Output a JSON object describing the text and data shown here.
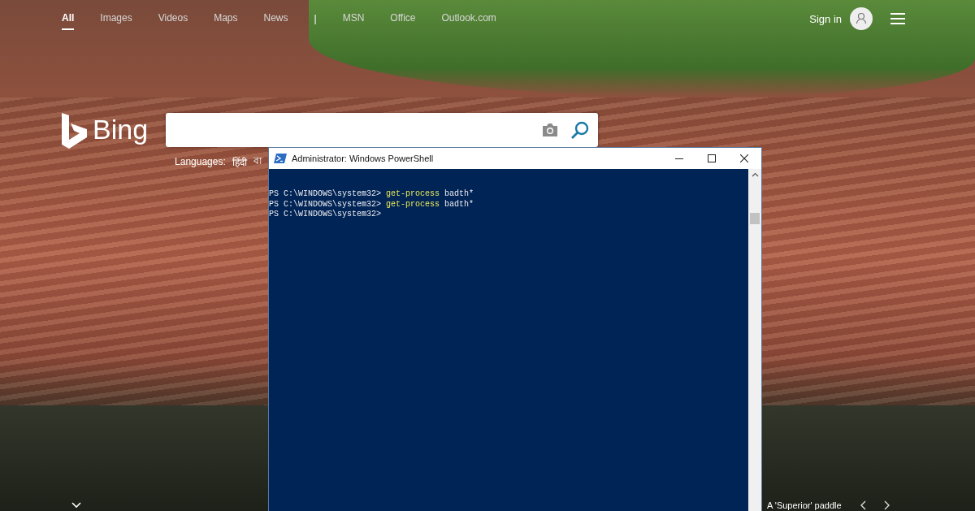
{
  "nav": [
    {
      "label": "All",
      "kind": "link",
      "selected": true
    },
    {
      "label": "Images",
      "kind": "link",
      "selected": false
    },
    {
      "label": "Videos",
      "kind": "link",
      "selected": false
    },
    {
      "label": "Maps",
      "kind": "link",
      "selected": false
    },
    {
      "label": "News",
      "kind": "link",
      "selected": false
    },
    {
      "label": "|",
      "kind": "separator"
    },
    {
      "label": "MSN",
      "kind": "link",
      "selected": false
    },
    {
      "label": "Office",
      "kind": "link",
      "selected": false
    },
    {
      "label": "Outlook.com",
      "kind": "link",
      "selected": false
    }
  ],
  "account": {
    "sign_in": "Sign in"
  },
  "logo": {
    "text": "Bing"
  },
  "languages": {
    "label": "Languages:",
    "items": [
      "हिंदी",
      "বা"
    ]
  },
  "image_caption": {
    "text": "A 'Superior' paddle"
  },
  "powershell": {
    "title": "Administrator: Windows PowerShell",
    "lines": [
      {
        "prompt": "PS C:\\WINDOWS\\system32>",
        "command": "get-process",
        "argument": "badth*"
      },
      {
        "prompt": "PS C:\\WINDOWS\\system32>",
        "command": "get-process",
        "argument": "badth*"
      },
      {
        "prompt": "PS C:\\WINDOWS\\system32>"
      }
    ]
  }
}
